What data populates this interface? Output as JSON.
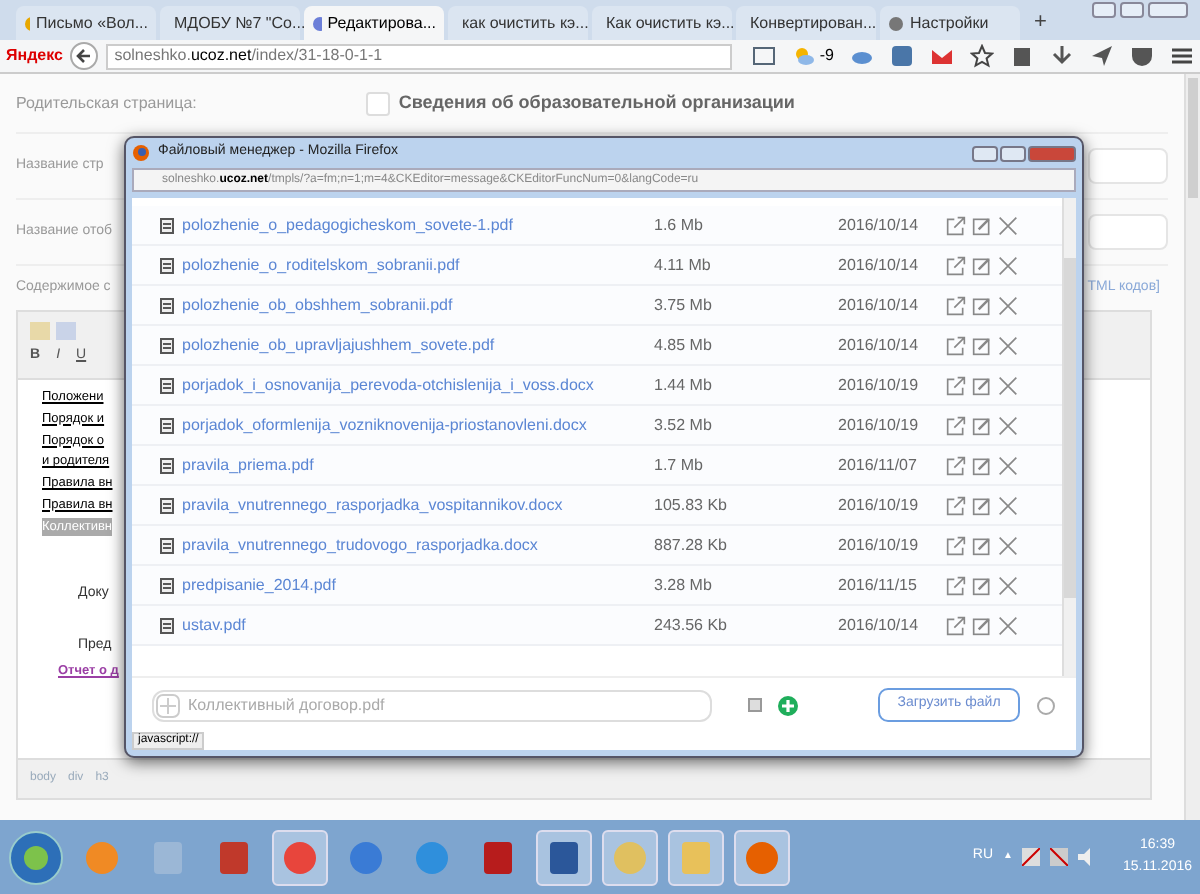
{
  "browser": {
    "tabs": [
      {
        "label": "Письмо «Вол...",
        "selected": false
      },
      {
        "label": "МДОБУ №7 \"Со...",
        "selected": false
      },
      {
        "label": "Редактирова...",
        "selected": true
      },
      {
        "label": "как очистить кэ...",
        "selected": false
      },
      {
        "label": "Как очистить кэ...",
        "selected": false
      },
      {
        "label": "Конвертирован...",
        "selected": false
      },
      {
        "label": "Настройки",
        "selected": false
      }
    ],
    "new_tab": "+",
    "logo": "Яндекс",
    "url_host": "solneshko.",
    "url_domain": "ucoz.net",
    "url_path": "/index/31-18-0-1-1",
    "weather": "-9"
  },
  "page": {
    "parent_label": "Родительская страница:",
    "parent_value": "Сведения об образовательной организации",
    "field_labels": [
      "Название стр",
      "Название отоб"
    ],
    "content_label": "Содержимое с",
    "html_link": "TML кодов]",
    "format_buttons": [
      "B",
      "I",
      "U"
    ],
    "editor_lines": [
      {
        "text": "Положени",
        "selected": false
      },
      {
        "text": "Порядок и",
        "selected": false
      },
      {
        "text": "Порядок о",
        "selected": false
      },
      {
        "text": "и родителя",
        "selected": false
      },
      {
        "text": "Правила вн",
        "selected": false
      },
      {
        "text": "Правила вн",
        "selected": false
      },
      {
        "text": "Коллективн",
        "selected": true
      }
    ],
    "doc_labels": [
      "Доку",
      "Пред"
    ],
    "report_link": "Отчет о д",
    "path": [
      "body",
      "div",
      "h3"
    ]
  },
  "dialog": {
    "title": "Файловый менеджер - Mozilla Firefox",
    "url_host": "solneshko.",
    "url_domain": "ucoz.net",
    "url_path": "/tmpls/?a=fm;n=1;m=4&CKEditor=message&CKEditorFuncNum=0&langCode=ru",
    "files": [
      {
        "name": "polozhenie_o_pedagogicheskom_sovete-1.pdf",
        "size": "1.6 Mb",
        "date": "2016/10/14"
      },
      {
        "name": "polozhenie_o_roditelskom_sobranii.pdf",
        "size": "4.11 Mb",
        "date": "2016/10/14"
      },
      {
        "name": "polozhenie_ob_obshhem_sobranii.pdf",
        "size": "3.75 Mb",
        "date": "2016/10/14"
      },
      {
        "name": "polozhenie_ob_upravljajushhem_sovete.pdf",
        "size": "4.85 Mb",
        "date": "2016/10/14"
      },
      {
        "name": "porjadok_i_osnovanija_perevoda-otchislenija_i_voss.docx",
        "size": "1.44 Mb",
        "date": "2016/10/19"
      },
      {
        "name": "porjadok_oformlenija_vozniknovenija-priostanovleni.docx",
        "size": "3.52 Mb",
        "date": "2016/10/19"
      },
      {
        "name": "pravila_priema.pdf",
        "size": "1.7 Mb",
        "date": "2016/11/07"
      },
      {
        "name": "pravila_vnutrennego_rasporjadka_vospitannikov.docx",
        "size": "105.83 Kb",
        "date": "2016/10/19"
      },
      {
        "name": "pravila_vnutrennego_trudovogo_rasporjadka.docx",
        "size": "887.28 Kb",
        "date": "2016/10/19"
      },
      {
        "name": "predpisanie_2014.pdf",
        "size": "3.28 Mb",
        "date": "2016/11/15"
      },
      {
        "name": "ustav.pdf",
        "size": "243.56 Kb",
        "date": "2016/10/14"
      }
    ],
    "upload_placeholder": "Коллективный договор.pdf",
    "checkbox": {
      "checked": false
    },
    "upload_button": "Загрузить файл",
    "status": "javascript://"
  },
  "taskbar": {
    "lang": "RU",
    "tray_arrow": "▲",
    "time": "16:39",
    "date": "15.11.2016"
  }
}
